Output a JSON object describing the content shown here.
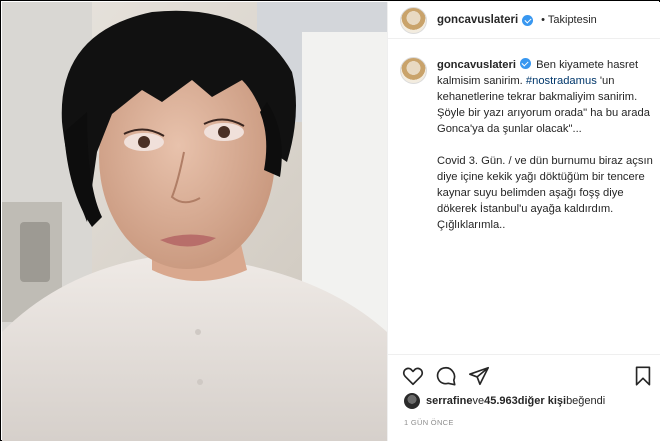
{
  "post": {
    "username": "goncavuslateri",
    "follow_status": "• Takiptesin",
    "caption": {
      "username": "goncavuslateri",
      "text_1": " Ben kiyamete hasret kalmisim sanirim. ",
      "hashtag": "#nostradamus",
      "text_2": " 'un kehanetlerine tekrar bakmaliyim sanirim. Şöyle bir yazı arıyorum orada\" ha bu arada Gonca'ya da şunlar olacak\"...",
      "text_3": "Covid 3. Gün. / ve dün burnumu biraz açsın diye içine kekik yağı döktüğüm bir tencere kaynar suyu belimden aşağı foşş diye dökerek İstanbul'u ayağa kaldırdım. Çığlıklarımla.."
    },
    "likes": {
      "user": "serrafine",
      "text_mid": " ve ",
      "count": "45.963",
      "text_rest": " diğer kişi",
      "suffix": " beğendi"
    },
    "time_ago": "1 GÜN ÖNCE"
  },
  "icons": [
    "heart-icon",
    "comment-icon",
    "share-icon",
    "bookmark-icon",
    "verified-badge-icon"
  ],
  "colors": {
    "verified": "#3897f0",
    "hashtag": "#00376b",
    "muted": "#8e8e8e"
  }
}
